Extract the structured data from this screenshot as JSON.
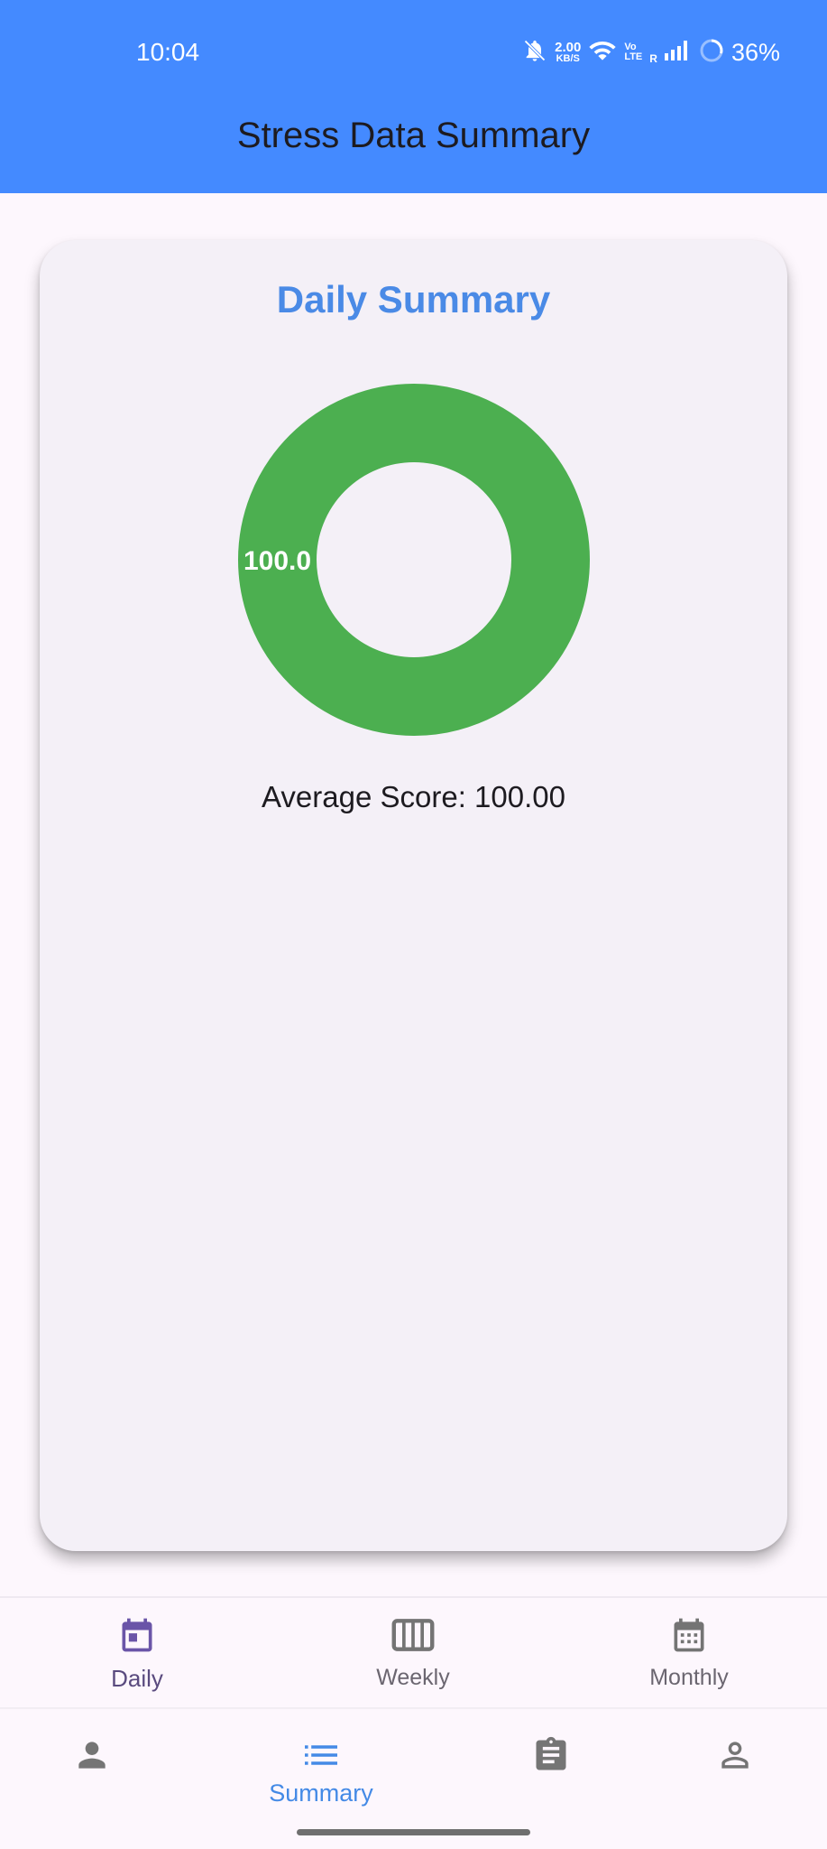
{
  "status_bar": {
    "time": "10:04",
    "net_speed": "2.00",
    "net_unit": "KB/S",
    "volte_top": "Vo",
    "volte_bottom": "LTE",
    "roaming": "R",
    "battery": "36%"
  },
  "app_bar": {
    "title": "Stress Data Summary"
  },
  "card": {
    "title": "Daily Summary",
    "average_label": "Average Score: 100.00"
  },
  "chart_data": {
    "type": "pie",
    "variant": "donut",
    "slices": [
      {
        "label": "100.0",
        "value": 100.0,
        "color": "#4caf50"
      }
    ]
  },
  "period_tabs": [
    {
      "label": "Daily",
      "icon": "calendar-today-icon",
      "selected": true
    },
    {
      "label": "Weekly",
      "icon": "view-week-icon",
      "selected": false
    },
    {
      "label": "Monthly",
      "icon": "calendar-month-icon",
      "selected": false
    }
  ],
  "bottom_nav": [
    {
      "label": "",
      "icon": "person-icon",
      "selected": false
    },
    {
      "label": "Summary",
      "icon": "list-icon",
      "selected": true
    },
    {
      "label": "",
      "icon": "assignment-icon",
      "selected": false
    },
    {
      "label": "",
      "icon": "person-outline-icon",
      "selected": false
    }
  ],
  "colors": {
    "app_bar": "#448aff",
    "accent": "#448ae6",
    "donut": "#4caf50",
    "selected_tab": "#6a55a8",
    "inactive_icon": "#747474"
  }
}
